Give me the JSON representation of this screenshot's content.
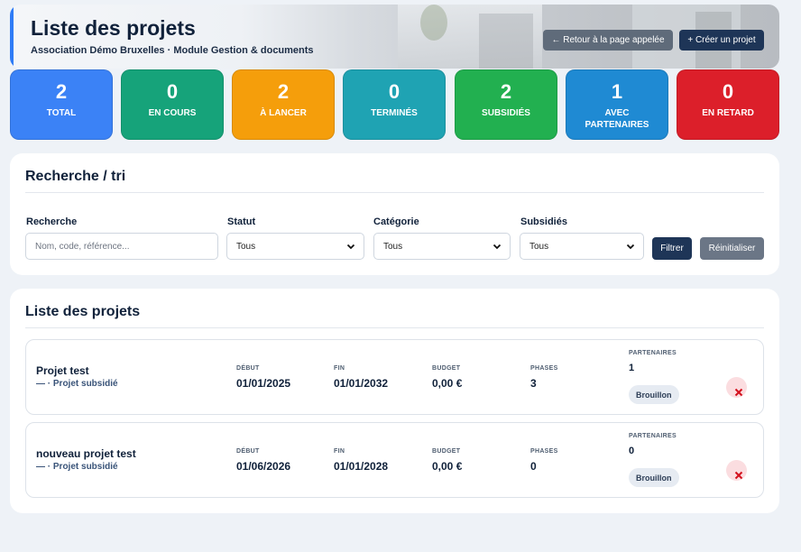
{
  "header": {
    "title": "Liste des projets",
    "subtitle": "Association Démo Bruxelles · Module Gestion & documents",
    "back_label": "← Retour à la page appelée",
    "create_label": "+ Créer un projet"
  },
  "stats": [
    {
      "value": "2",
      "label": "TOTAL",
      "color": "#3b82f6"
    },
    {
      "value": "0",
      "label": "EN COURS",
      "color": "#16a37a"
    },
    {
      "value": "2",
      "label": "À LANCER",
      "color": "#f59e0b"
    },
    {
      "value": "0",
      "label": "TERMINÉS",
      "color": "#1fa3b3"
    },
    {
      "value": "2",
      "label": "SUBSIDIÉS",
      "color": "#22b050"
    },
    {
      "value": "1",
      "label": "AVEC PARTENAIRES",
      "color": "#1f8ad3"
    },
    {
      "value": "0",
      "label": "EN RETARD",
      "color": "#dc1f2a"
    }
  ],
  "search": {
    "title": "Recherche / tri",
    "search_label": "Recherche",
    "search_placeholder": "Nom, code, référence...",
    "statut_label": "Statut",
    "statut_value": "Tous",
    "categorie_label": "Catégorie",
    "categorie_value": "Tous",
    "subsidies_label": "Subsidiés",
    "subsidies_value": "Tous",
    "filter_label": "Filtrer",
    "reset_label": "Réinitialiser"
  },
  "list": {
    "title": "Liste des projets",
    "labels": {
      "debut": "DÉBUT",
      "fin": "FIN",
      "budget": "BUDGET",
      "phases": "PHASES",
      "partenaires": "PARTENAIRES"
    },
    "projects": [
      {
        "name": "Projet test",
        "type": "— · Projet subsidié",
        "debut": "01/01/2025",
        "fin": "01/01/2032",
        "budget": "0,00 €",
        "phases": "3",
        "partenaires": "1",
        "status": "Brouillon"
      },
      {
        "name": "nouveau projet test",
        "type": "— · Projet subsidié",
        "debut": "01/06/2026",
        "fin": "01/01/2028",
        "budget": "0,00 €",
        "phases": "0",
        "partenaires": "0",
        "status": "Brouillon"
      }
    ]
  },
  "icons": {
    "chevron": "chevron-down-icon",
    "delete": "close-icon"
  }
}
